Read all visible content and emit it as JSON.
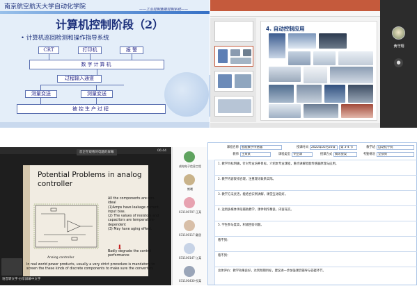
{
  "panel1": {
    "university": "南京航空航天大学自动化学院",
    "series": "——工业控制集散控制系统——",
    "title": "计算机控制阶段（2）",
    "bullet": "计算机巡回检测和操作指导系统",
    "boxes": {
      "crt": "CRT",
      "printer": "打印机",
      "alarm": "报  警",
      "computer": "数字计算机",
      "input_channel": "过程输入通道",
      "transmitter1": "测量变送",
      "transmitter2": "测量变送",
      "process": "被控生产过程"
    }
  },
  "panel2": {
    "slide_title": "4. 自动控制应用"
  },
  "panel3": {
    "name": "黄守翔"
  },
  "panel4": {
    "top_tag": "您正在观看的电脑的屏幕",
    "clock": "06:44",
    "title_line1": "Potential Problems in analog",
    "title_line2": "controller",
    "points": "All the components are non-ideal\n(1)Amps have leakage current, input bias.\n(2) The values of resistors and capacitors are temperature-dependent\n(3) May have aging effect.",
    "degrade": "Badly degrade the control performance",
    "analog_label": "Analog controller",
    "real_world": "In real world power products, usually a very strict procedure is mandatory to screen the these kinds of discrete components to make sure the converters",
    "subtitle": "语音转文字·分享屏幕中文字"
  },
  "panel5": {
    "participants": [
      {
        "name": "成电电子信息工程",
        "color": "#5fa35f"
      },
      {
        "name": "熊曦",
        "color": "#c9b38a"
      },
      {
        "name": "031100707-王某",
        "color": "#e7a2b0"
      },
      {
        "name": "031100117-戴思",
        "color": "#d8bfa8"
      },
      {
        "name": "031100147-江某",
        "color": "#c7d3e6"
      },
      {
        "name": "031100430-倪某",
        "color": "#9aa5b8"
      }
    ]
  },
  "panel6": {
    "row1": {
      "lbl_course": "课程名称",
      "course": "智能数字传感器",
      "lbl_date": "授课时间",
      "date": "2022年05月20日",
      "week": "第 3-4 节",
      "lbl_class": "教学班",
      "class": "自动化学院"
    },
    "row2": {
      "lbl_teacher": "教师",
      "teacher": "王某某",
      "lbl_type": "课程类型",
      "type": "专业课",
      "lbl_mode": "授课方式",
      "mode": "腾讯会议",
      "lbl_attend": "考勤情况",
      "attend": "全部到"
    },
    "sections": [
      "1. 教学目标明确，针对专业培养目标，介绍本专业课程，重点讲解智能传感器原理与应用。",
      "2. 教学内容安排合理，注重理论联系实际。",
      "3. 教学方法灵活，能结合实例讲解，课堂互动较好。",
      "4. 运用多媒体手段辅助教学，课件制作精良，内容充实。",
      "5. 学生参与度高，积极回答问题。",
      "看不到：",
      "看不到：",
      "总体评价：教学效果良好，达到预期目标，建议进一步加强课后辅导与答疑环节。"
    ]
  }
}
